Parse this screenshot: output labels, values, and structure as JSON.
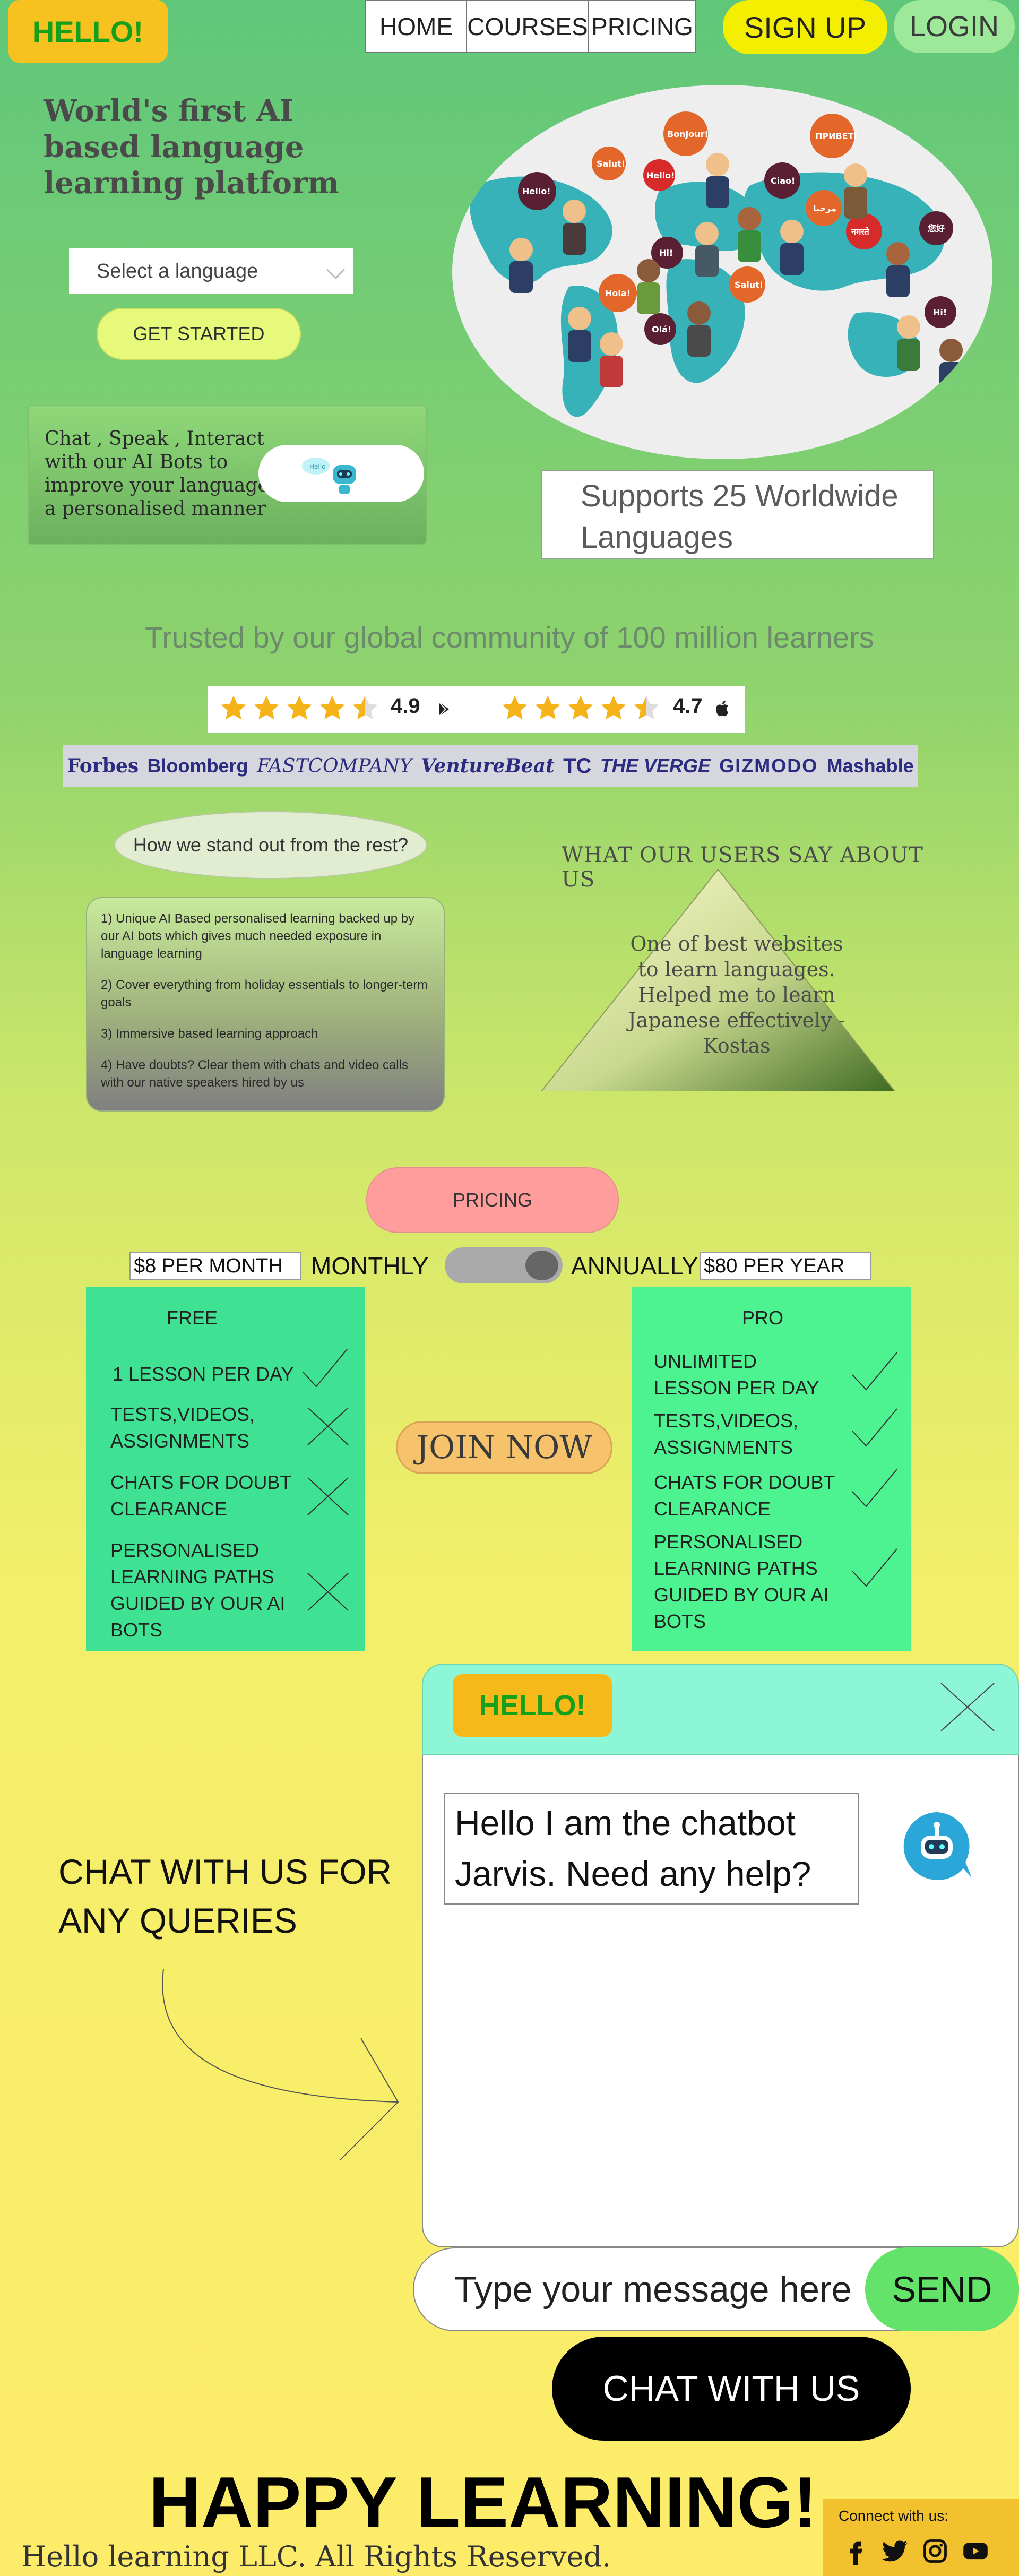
{
  "header": {
    "logo": "HELLO!",
    "nav": [
      "HOME",
      "COURSES",
      "PRICING"
    ],
    "signup": "SIGN UP",
    "login": "LOGIN"
  },
  "hero": {
    "title": "World's first AI based language learning platform",
    "language_placeholder": "Select a language",
    "get_started": "GET STARTED",
    "chat_card_text": "Chat , Speak , Interact with our AI Bots to improve your language in a personalised manner",
    "bot_greeting": "Hello",
    "supports": "Supports 25 Worldwide Languages"
  },
  "world_map": {
    "greetings": [
      "Hello!",
      "Salut!",
      "Hello!",
      "Bonjour!",
      "ПРИВЕТ!",
      "Ciao!",
      "مرحبا",
      "नमस्ते",
      "您好",
      "Hi!",
      "Hola!",
      "Salut!",
      "Olá!",
      "Hi!"
    ]
  },
  "trust": {
    "headline": "Trusted by our global community of 100 million learners",
    "rating_play": "4.9",
    "rating_apple": "4.7",
    "stars_play": 4.5,
    "stars_apple": 4.5
  },
  "press": [
    "Forbes",
    "Bloomberg",
    "FASTCOMPANY",
    "VentureBeat",
    "TC",
    "THE VERGE",
    "GIZMODO",
    "Mashable"
  ],
  "standout": {
    "question": "How we stand out from the rest?",
    "points": [
      "1) Unique AI Based personalised learning  backed up by our AI bots which gives much  needed exposure in language learning",
      "2) Cover everything from holiday essentials to longer-term goals",
      "3) Immersive based learning approach",
      "4) Have doubts? Clear them with chats and video calls with our native speakers hired by us"
    ]
  },
  "testimonial": {
    "heading": "WHAT OUR USERS SAY ABOUT US",
    "quote": "One of best websites to learn languages. Helped me to learn Japanese effectively -Kostas"
  },
  "pricing": {
    "button": "PRICING",
    "monthly_price": "$8 PER MONTH",
    "monthly_label": "MONTHLY",
    "annual_label": "ANNUALLY",
    "annual_price": "$80 PER YEAR",
    "join_now": "JOIN NOW",
    "free": {
      "title": "FREE",
      "items": [
        {
          "text": "1 LESSON PER DAY",
          "included": true
        },
        {
          "text": "TESTS,VIDEOS, ASSIGNMENTS",
          "included": false
        },
        {
          "text": "CHATS FOR DOUBT CLEARANCE",
          "included": false
        },
        {
          "text": "PERSONALISED LEARNING PATHS GUIDED BY OUR AI BOTS",
          "included": false
        }
      ]
    },
    "pro": {
      "title": "PRO",
      "items": [
        {
          "text": "UNLIMITED LESSON PER DAY",
          "included": true
        },
        {
          "text": "TESTS,VIDEOS, ASSIGNMENTS",
          "included": true
        },
        {
          "text": "CHATS FOR DOUBT CLEARANCE",
          "included": true
        },
        {
          "text": "PERSONALISED LEARNING PATHS GUIDED BY OUR AI BOTS",
          "included": true
        }
      ]
    }
  },
  "chat": {
    "side_text": "CHAT WITH US FOR ANY QUERIES",
    "header_logo": "HELLO!",
    "bot_message": "Hello I am the chatbot Jarvis. Need any help?",
    "input_placeholder": "Type your message here",
    "send": "SEND",
    "chat_button": "CHAT WITH US"
  },
  "footer": {
    "happy": "HAPPY LEARNING!",
    "copyright": "Hello learning LLC. All Rights Reserved.",
    "connect": "Connect with us:",
    "socials": [
      "facebook-icon",
      "twitter-icon",
      "instagram-icon",
      "youtube-icon"
    ]
  },
  "colors": {
    "brand_yellow": "#f7c11f",
    "brand_green_text": "#14a01a",
    "send_green": "#63e36a",
    "pricing_pink": "#ff9c9c"
  }
}
